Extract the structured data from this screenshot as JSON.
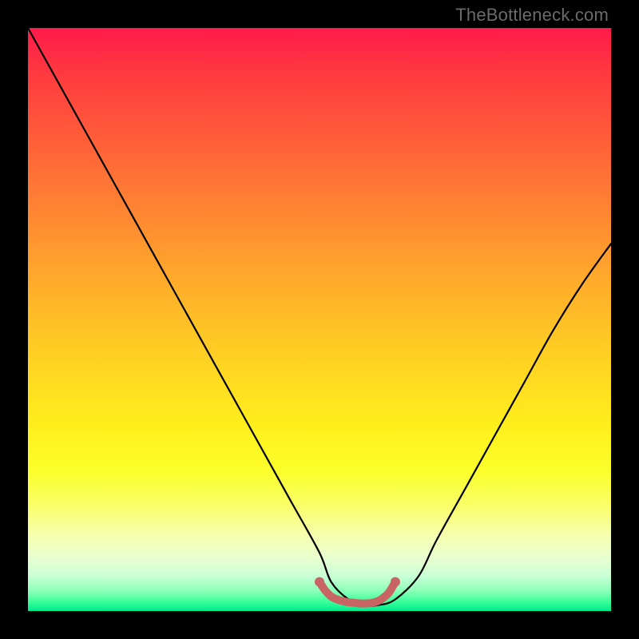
{
  "watermark": "TheBottleneck.com",
  "chart_data": {
    "type": "line",
    "title": "",
    "xlabel": "",
    "ylabel": "",
    "xlim": [
      0,
      100
    ],
    "ylim": [
      0,
      100
    ],
    "grid": false,
    "series": [
      {
        "name": "bottleneck-curve",
        "x": [
          0,
          5,
          10,
          15,
          20,
          25,
          30,
          35,
          40,
          45,
          50,
          52,
          55,
          58,
          60,
          63,
          67,
          70,
          75,
          80,
          85,
          90,
          95,
          100
        ],
        "values": [
          100,
          91,
          82,
          73,
          64,
          55,
          46,
          37,
          28,
          19,
          10,
          5,
          2,
          1,
          1,
          2,
          6,
          12,
          21,
          30,
          39,
          48,
          56,
          63
        ]
      },
      {
        "name": "optimal-range-marker",
        "x": [
          50,
          51,
          52,
          53,
          54,
          55,
          56,
          57,
          58,
          59,
          60,
          61,
          62,
          63
        ],
        "values": [
          5,
          3.5,
          2.5,
          2,
          1.7,
          1.5,
          1.4,
          1.3,
          1.3,
          1.4,
          1.7,
          2.3,
          3.3,
          5
        ]
      }
    ],
    "colors": {
      "curve": "#000000",
      "marker": "#c86464",
      "gradient_top": "#ff1a4b",
      "gradient_bottom": "#00e88c"
    }
  }
}
